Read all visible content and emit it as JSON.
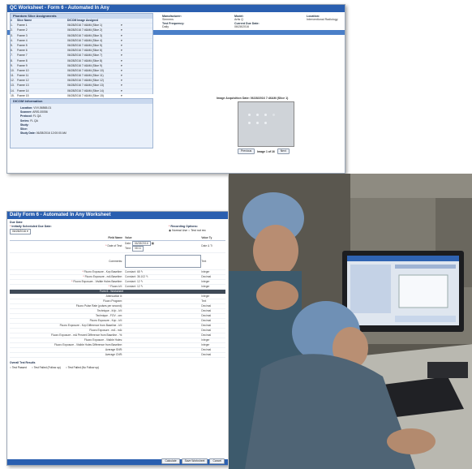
{
  "window1": {
    "title": "QC Worksheet - Form 6 - Automated In Any",
    "meta": [
      {
        "label": "Device Name:",
        "value": "ID 65 03"
      },
      {
        "label": "Device ID/Tag ID:",
        "value": "44441"
      },
      {
        "label": "Manufacturer:",
        "value": "Siemens"
      },
      {
        "label": "Model:",
        "value": "Artis Q"
      },
      {
        "label": "Location:",
        "value": "Interventional Radiology"
      },
      {
        "label": "QC Test:",
        "value": "Form 6 - Automated In Any"
      },
      {
        "label": "Worksheet ID:",
        "value": ""
      },
      {
        "label": "Test Frequency:",
        "value": "Daily"
      },
      {
        "label": "Current Due Date:",
        "value": "06/28/2016"
      }
    ],
    "section_title": "Phantom Analysis",
    "slice_panel": {
      "title": "Phantom Slice Assignments",
      "headers": [
        "#",
        "Slice Name",
        "DICOM Image Assigned"
      ],
      "rows": [
        {
          "n": "1.",
          "name": "Frame 1",
          "image": "06/28/2016 7:46AM (Slice 1)"
        },
        {
          "n": "2.",
          "name": "Frame 2",
          "image": "06/28/2016 7:46AM (Slice 2)"
        },
        {
          "n": "3.",
          "name": "Frame 3",
          "image": "06/28/2016 7:46AM (Slice 3)"
        },
        {
          "n": "4.",
          "name": "Frame 4",
          "image": "06/28/2016 7:46AM (Slice 4)"
        },
        {
          "n": "5.",
          "name": "Frame 5",
          "image": "06/28/2016 7:46AM (Slice 5)"
        },
        {
          "n": "6.",
          "name": "Frame 6",
          "image": "06/28/2016 7:46AM (Slice 6)"
        },
        {
          "n": "7.",
          "name": "Frame 7",
          "image": "06/28/2016 7:46AM (Slice 7)"
        },
        {
          "n": "8.",
          "name": "Frame 8",
          "image": "06/28/2016 7:46AM (Slice 8)"
        },
        {
          "n": "9.",
          "name": "Frame 9",
          "image": "06/28/2016 7:46AM (Slice 9)"
        },
        {
          "n": "10.",
          "name": "Frame 10",
          "image": "06/28/2016 7:46AM (Slice 10)"
        },
        {
          "n": "11.",
          "name": "Frame 11",
          "image": "06/28/2016 7:46AM (Slice 11)"
        },
        {
          "n": "12.",
          "name": "Frame 12",
          "image": "06/28/2016 7:46AM (Slice 12)"
        },
        {
          "n": "13.",
          "name": "Frame 13",
          "image": "06/28/2016 7:46AM (Slice 13)"
        },
        {
          "n": "14.",
          "name": "Frame 14",
          "image": "06/28/2016 7:46AM (Slice 14)"
        },
        {
          "n": "15.",
          "name": "Frame 15",
          "image": "06/28/2016 7:46AM (Slice 15)"
        },
        {
          "n": "16.",
          "name": "Frame 16",
          "image": "06/28/2016 7:46AM (Slice 16)"
        }
      ]
    },
    "dicom_panel": {
      "title": "DICOM Information",
      "rows": [
        {
          "label": "Location:",
          "value": "VVV-56565-01"
        },
        {
          "label": "Scanner:",
          "value": "ARIS-00056"
        },
        {
          "label": "Protocol:",
          "value": "FL QA"
        },
        {
          "label": "Series:",
          "value": "FL QA"
        },
        {
          "label": "Study:",
          "value": ""
        },
        {
          "label": "Slice:",
          "value": ""
        },
        {
          "label": "Study Date:",
          "value": "06/28/2016 12:00:00 AM"
        }
      ]
    },
    "preview": {
      "caption": "Image Acquisition Date: 06/28/2016 7:46AM (Slice 1)",
      "previous": "Previous",
      "counter": "Image 1 of 16",
      "next": "Next"
    }
  },
  "window2": {
    "title": "Daily Form 6 - Automated In Any Worksheet",
    "due_date_heading": "Due Date",
    "sched_label": "Initially Scheduled Due Date:",
    "sched_value": "06/28/2016",
    "rec_label": "Recording Options:",
    "rec_normal": "Normal Use",
    "rec_fail": "Test not rec",
    "headers": {
      "field": "Field Name",
      "value": "Value",
      "type": "Value Ty"
    },
    "date_label": "Date of Test:",
    "date_value": "06/28/2016",
    "time_value": "08:11",
    "date_type": "Date & Ti",
    "comments_label": "Comments:",
    "comments_type": "Text",
    "constant_rows": [
      {
        "name": "Fluoro Exposure - Kvp Baseline:",
        "value": "Constant: 68",
        "type": "Integer"
      },
      {
        "name": "Fluoro Exposure - mA Baseline:",
        "value": "Constant: 36.102",
        "type": "Decimal"
      },
      {
        "name": "Fluoro Exposure - Visible Holes Baseline:",
        "value": "Constant: 12",
        "type": "Integer"
      },
      {
        "name": "Fluoro kV:",
        "value": "Constant: 12",
        "type": "Integer"
      }
    ],
    "separator": "Form 6 - Worksheet",
    "data_rows": [
      {
        "name": "Attenuation #:",
        "type": "Integer"
      },
      {
        "name": "Fluoro Program:",
        "type": "Text"
      },
      {
        "name": "Fluoro Pulse Rate (pulses per second):",
        "type": "Decimal"
      },
      {
        "name": "Technique - kVp - kV:",
        "type": "Decimal"
      },
      {
        "name": "Technique - FOV - cm:",
        "type": "Decimal"
      },
      {
        "name": "Fluoro Exposure - Kvp - kV:",
        "type": "Decimal"
      },
      {
        "name": "Fluoro Exposure - Kvp Difference from Baseline - kV:",
        "type": "Decimal"
      },
      {
        "name": "Fluoro Exposure - mA - mA:",
        "type": "Decimal"
      },
      {
        "name": "Fluoro Exposure - mA Percent Difference from Baseline - %:",
        "type": "Decimal"
      },
      {
        "name": "Fluoro Exposure - Visible Holes:",
        "type": "Integer"
      },
      {
        "name": "Fluoro Exposure - Visible Holes Difference from Baseline:",
        "type": "Integer"
      },
      {
        "name": "Average SNR:",
        "type": "Decimal"
      },
      {
        "name": "Average CNR:",
        "type": "Decimal"
      }
    ],
    "overall_heading": "Overall Test Results",
    "results": [
      "Test Passed",
      "Test Failed (Follow up)",
      "Test Failed (No Follow up)"
    ],
    "buttons": [
      "Calculate",
      "Save Worksheet",
      "Cancel"
    ]
  }
}
